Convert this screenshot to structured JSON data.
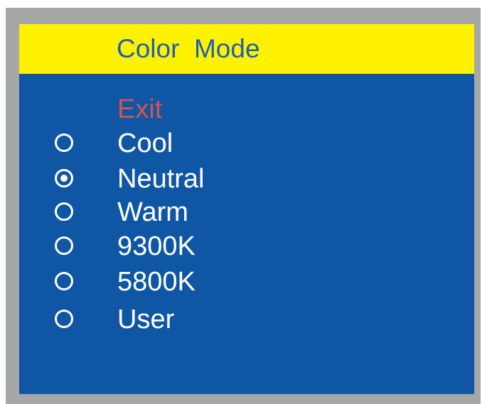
{
  "menu": {
    "title": "Color  Mode",
    "exit_label": "Exit",
    "options": [
      {
        "label": "Cool",
        "selected": false
      },
      {
        "label": "Neutral",
        "selected": true
      },
      {
        "label": "Warm",
        "selected": false
      },
      {
        "label": "9300K",
        "selected": false
      },
      {
        "label": "5800K",
        "selected": false
      },
      {
        "label": "User",
        "selected": false
      }
    ]
  },
  "colors": {
    "title_bar": "#fff200",
    "panel": "#0f57a4",
    "title_text": "#1f5fb3",
    "exit_text": "#d4534c",
    "option_text": "#ffffff",
    "frame": "#a6a7a7"
  }
}
